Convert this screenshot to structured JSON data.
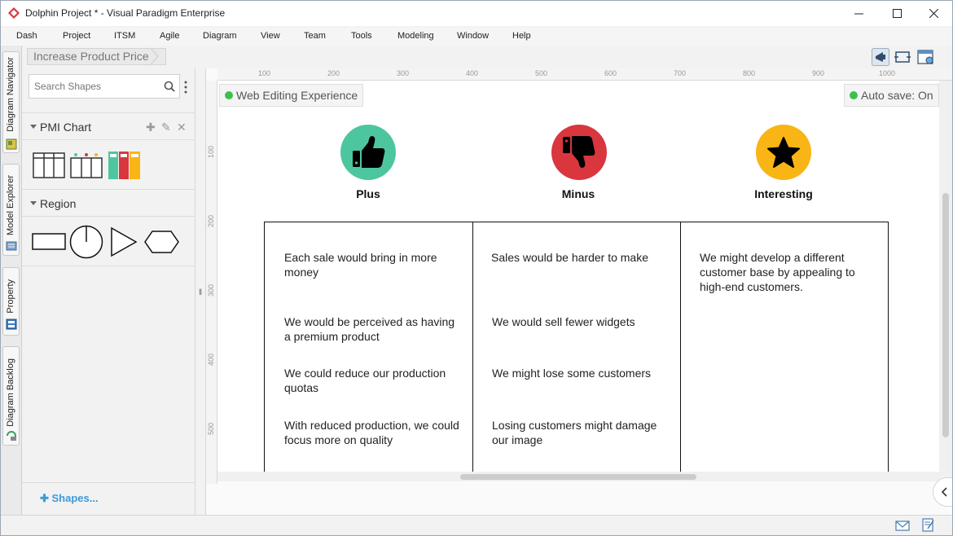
{
  "window": {
    "title": "Dolphin Project * - Visual Paradigm Enterprise",
    "minimize_icon": "minimize-icon",
    "maximize_icon": "maximize-icon",
    "close_icon": "close-icon"
  },
  "menu": {
    "items": [
      "Dash",
      "Project",
      "ITSM",
      "Agile",
      "Diagram",
      "View",
      "Team",
      "Tools",
      "Modeling",
      "Window",
      "Help"
    ]
  },
  "breadcrumb": {
    "label": "Increase Product Price"
  },
  "toolbar": {
    "icons": [
      "announcement-icon",
      "fit-diagram-icon",
      "layout-settings-icon"
    ]
  },
  "side_tabs": {
    "items": [
      "Diagram Navigator",
      "Model Explorer",
      "Property",
      "Diagram Backlog"
    ]
  },
  "shapes_panel": {
    "search_placeholder": "Search Shapes",
    "sections": [
      {
        "title": "PMI Chart",
        "shapes": [
          "pmi-table-shape",
          "pmi-labeled-table-shape",
          "pmi-colored-chart-shape"
        ]
      },
      {
        "title": "Region",
        "shapes": [
          "rectangle-shape",
          "circle-shape",
          "triangle-shape",
          "hexagon-shape"
        ]
      }
    ],
    "shapes_link": "Shapes..."
  },
  "ruler": {
    "top_ticks": [
      "100",
      "200",
      "300",
      "400",
      "500",
      "600",
      "700",
      "800",
      "900",
      "1000"
    ],
    "left_ticks": [
      "100",
      "200",
      "300",
      "400",
      "500"
    ]
  },
  "diagram": {
    "web_editing_label": "Web Editing Experience",
    "autosave_label": "Auto save: On",
    "columns": [
      {
        "heading": "Plus",
        "icon": "thumbs-up-icon",
        "color": "#4dc6a0",
        "items": [
          "Each sale would bring in more money",
          "We would be perceived as having a premium product",
          "We could reduce our production quotas",
          "With reduced production, we could focus more on quality"
        ]
      },
      {
        "heading": "Minus",
        "icon": "thumbs-down-icon",
        "color": "#d9363e",
        "items": [
          "Sales would be harder to make",
          "We would sell fewer widgets",
          "We might lose some customers",
          "Losing customers might damage our image"
        ]
      },
      {
        "heading": "Interesting",
        "icon": "star-icon",
        "color": "#f9b515",
        "items": [
          "We might develop a different customer base by appealing to high-end customers."
        ]
      }
    ]
  },
  "statusbar": {
    "icons": [
      "mail-icon",
      "notes-icon"
    ]
  }
}
